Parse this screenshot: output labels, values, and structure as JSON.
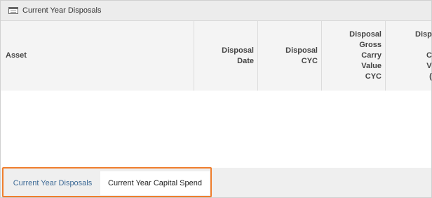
{
  "panel": {
    "title": "Current Year Disposals",
    "icon": "table-icon"
  },
  "grid": {
    "columns": [
      {
        "id": "asset",
        "lines": [
          "Asset"
        ]
      },
      {
        "id": "disposal-date",
        "lines": [
          "Disposal",
          "Date"
        ]
      },
      {
        "id": "disposal-cyc",
        "lines": [
          "Disposal",
          "CYC"
        ]
      },
      {
        "id": "disposal-gross-carry-value-cyc",
        "lines": [
          "Disposal",
          "Gross",
          "Carry",
          "Value",
          "CYC"
        ]
      },
      {
        "id": "disp-truncated",
        "lines": [
          "Disp",
          "",
          "C",
          "V",
          "("
        ]
      }
    ],
    "rows": []
  },
  "tabs": [
    {
      "label": "Current Year Disposals",
      "active": true
    },
    {
      "label": "Current Year Capital Spend",
      "active": false
    }
  ],
  "colors": {
    "highlight": "#ef7e2d",
    "active_tab_text": "#3d6a96"
  }
}
